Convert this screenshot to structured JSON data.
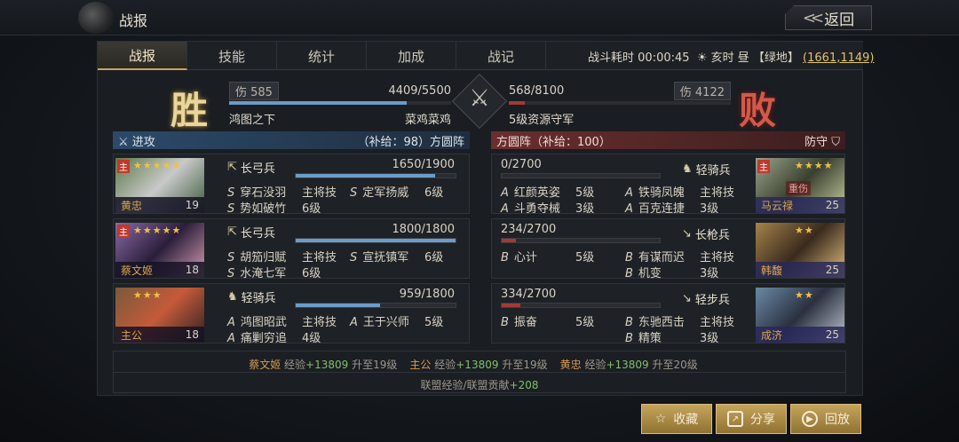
{
  "header": {
    "title": "战报",
    "back_label": "返回"
  },
  "tabs": [
    "战报",
    "技能",
    "统计",
    "加成",
    "战记"
  ],
  "battle_info": {
    "time_label": "战斗耗时",
    "time": "00:00:45",
    "period": "亥时 昼",
    "terrain": "【绿地】",
    "coord": "(1661,1149)"
  },
  "attacker": {
    "result": "胜",
    "damage": "伤 585",
    "hp": "4409/5500",
    "hp_frac": 0.8,
    "name": "鸿图之下",
    "player": "菜鸡菜鸡"
  },
  "defender": {
    "result": "败",
    "damage": "伤 4122",
    "hp": "568/8100",
    "hp_frac": 0.07,
    "name": "5级资源守军"
  },
  "left_header": {
    "label": "进攻",
    "supply": "（补给：98）方圆阵"
  },
  "right_header": {
    "label": "方圆阵（补给：100）",
    "tag": "防守"
  },
  "left_units": [
    {
      "name": "黄忠",
      "level": "19",
      "troop": "长弓兵",
      "hp": "1650/1900",
      "hp_frac": 0.87,
      "stars": "★★★★★",
      "skills": [
        {
          "g": "S",
          "n": "穿石没羽",
          "lv": "主将技"
        },
        {
          "g": "S",
          "n": "定军扬威",
          "lv": "6级"
        },
        {
          "g": "S",
          "n": "势如破竹",
          "lv": "6级"
        }
      ]
    },
    {
      "name": "蔡文姬",
      "level": "18",
      "troop": "长弓兵",
      "hp": "1800/1800",
      "hp_frac": 1.0,
      "stars": "★★★★★",
      "skills": [
        {
          "g": "S",
          "n": "胡笳归赋",
          "lv": "主将技"
        },
        {
          "g": "S",
          "n": "宣抚镇军",
          "lv": "6级"
        },
        {
          "g": "S",
          "n": "水淹七军",
          "lv": "6级"
        }
      ]
    },
    {
      "name": "主公",
      "level": "18",
      "troop": "轻骑兵",
      "hp": "959/1800",
      "hp_frac": 0.53,
      "stars": "★★★",
      "skills": [
        {
          "g": "A",
          "n": "鸿图昭武",
          "lv": "主将技"
        },
        {
          "g": "A",
          "n": "王于兴师",
          "lv": "5级"
        },
        {
          "g": "A",
          "n": "痛剿穷追",
          "lv": "4级"
        }
      ]
    }
  ],
  "right_units": [
    {
      "name": "马云禄",
      "level": "25",
      "troop": "轻骑兵",
      "hp": "0/2700",
      "hp_frac": 0.0,
      "status": "重伤",
      "stars": "★★★★",
      "skills": [
        {
          "g": "A",
          "n": "红颜英姿",
          "lv": "5级"
        },
        {
          "g": "A",
          "n": "铁骑凤魄",
          "lv": "主将技"
        },
        {
          "g": "A",
          "n": "斗勇夺械",
          "lv": "3级"
        },
        {
          "g": "A",
          "n": "百克连捷",
          "lv": "3级"
        }
      ]
    },
    {
      "name": "韩馥",
      "level": "25",
      "troop": "长枪兵",
      "hp": "234/2700",
      "hp_frac": 0.09,
      "stars": "★★",
      "skills": [
        {
          "g": "B",
          "n": "心计",
          "lv": "5级"
        },
        {
          "g": "B",
          "n": "有谋而迟",
          "lv": "主将技"
        },
        {
          "g": "B",
          "n": "机变",
          "lv": "3级"
        }
      ]
    },
    {
      "name": "成济",
      "level": "25",
      "troop": "轻步兵",
      "hp": "334/2700",
      "hp_frac": 0.12,
      "stars": "★★",
      "skills": [
        {
          "g": "B",
          "n": "振奋",
          "lv": "5级"
        },
        {
          "g": "B",
          "n": "东驰西击",
          "lv": "主将技"
        },
        {
          "g": "B",
          "n": "精策",
          "lv": "3级"
        }
      ]
    }
  ],
  "exp": {
    "line1": [
      {
        "n": "蔡文姬",
        "t": "经验",
        "p": "+13809",
        "u": "升至19级"
      },
      {
        "n": "主公",
        "t": "经验",
        "p": "+13809",
        "u": "升至19级"
      },
      {
        "n": "黄忠",
        "t": "经验",
        "p": "+13809",
        "u": "升至20级"
      }
    ],
    "line2_label": "联盟经验/联盟贡献",
    "line2_value": "+208"
  },
  "buttons": {
    "fav": "收藏",
    "share": "分享",
    "replay": "回放"
  },
  "colors": {
    "gold": "#c6a45c",
    "blue_bar": "#6a9cc9",
    "red_bar": "#a33a35"
  }
}
